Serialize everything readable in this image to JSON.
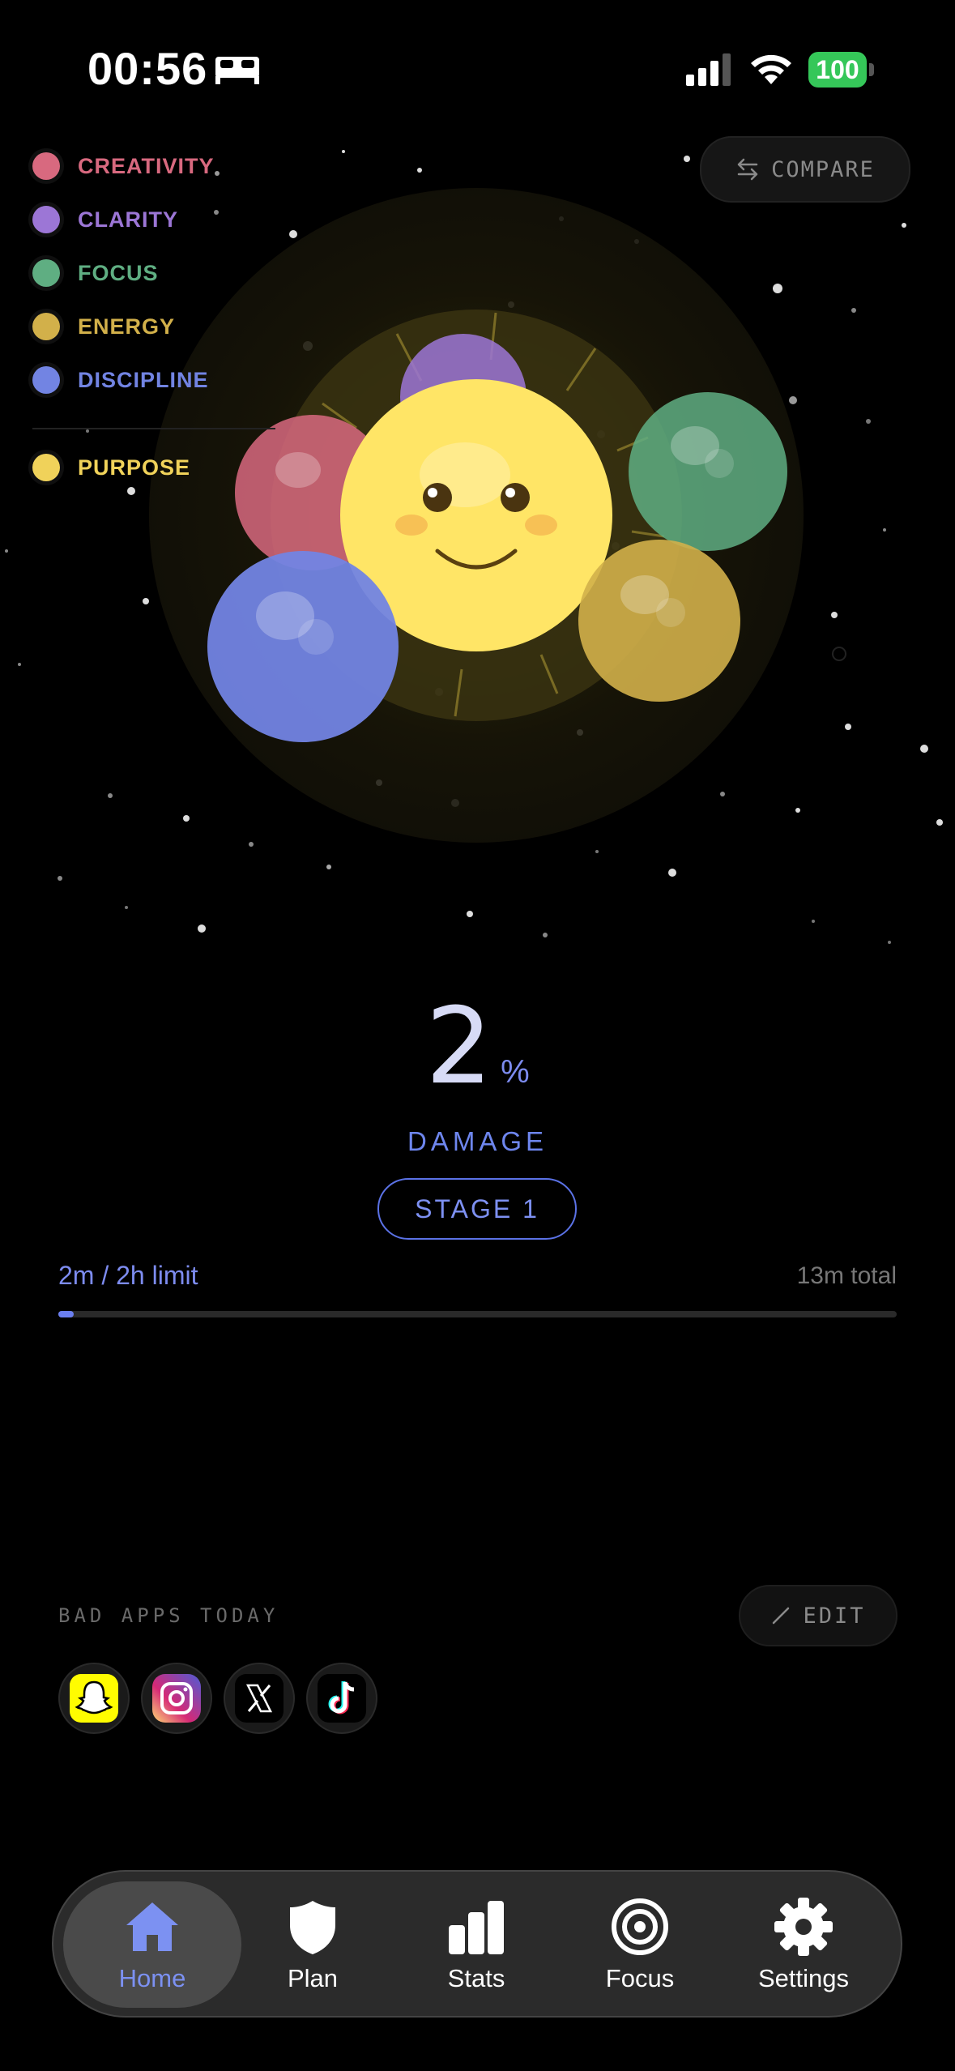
{
  "status": {
    "time": "00:56",
    "battery": "100"
  },
  "legend": [
    {
      "label": "CREATIVITY",
      "color": "#d8697f"
    },
    {
      "label": "CLARITY",
      "color": "#9c76d6"
    },
    {
      "label": "FOCUS",
      "color": "#5fae82"
    },
    {
      "label": "ENERGY",
      "color": "#d2b04a"
    },
    {
      "label": "DISCIPLINE",
      "color": "#7284e3"
    }
  ],
  "legend_purpose": {
    "label": "PURPOSE",
    "color": "#f0d25a"
  },
  "compare_label": "COMPARE",
  "damage": {
    "value": "2",
    "unit": "%",
    "label": "DAMAGE"
  },
  "stage_label": "STAGE 1",
  "usage": {
    "limit_text": "2m / 2h limit",
    "total_text": "13m total",
    "progress": 0.017
  },
  "bad_apps": {
    "title": "BAD APPS TODAY",
    "edit_label": "EDIT",
    "apps": [
      "snapchat-icon",
      "instagram-icon",
      "x-icon",
      "tiktok-icon"
    ]
  },
  "tabs": [
    {
      "label": "Home",
      "icon": "house-icon",
      "active": true
    },
    {
      "label": "Plan",
      "icon": "shield-icon"
    },
    {
      "label": "Stats",
      "icon": "bar-chart-icon"
    },
    {
      "label": "Focus",
      "icon": "target-icon"
    },
    {
      "label": "Settings",
      "icon": "gear-icon"
    }
  ],
  "colors": {
    "accent": "#6b7ff0",
    "background": "#000000"
  }
}
